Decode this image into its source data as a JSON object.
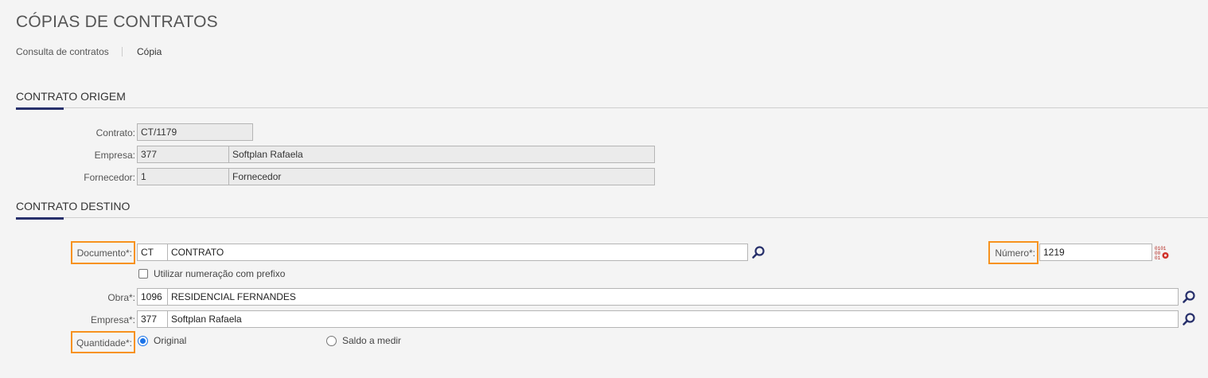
{
  "page": {
    "title": "CÓPIAS DE CONTRATOS"
  },
  "breadcrumb": {
    "items": [
      "Consulta de contratos",
      "Cópia"
    ]
  },
  "origem": {
    "title": "CONTRATO ORIGEM",
    "contrato": {
      "label": "Contrato:",
      "value": "CT/1179"
    },
    "empresa": {
      "label": "Empresa:",
      "code": "377",
      "name": "Softplan Rafaela"
    },
    "fornecedor": {
      "label": "Fornecedor:",
      "code": "1",
      "name": "Fornecedor"
    }
  },
  "destino": {
    "title": "CONTRATO DESTINO",
    "documento": {
      "label": "Documento*:",
      "code": "CT",
      "name": "CONTRATO"
    },
    "numero": {
      "label": "Número*:",
      "value": "1219"
    },
    "prefixo": {
      "label": "Utilizar numeração com prefixo",
      "checked": false
    },
    "obra": {
      "label": "Obra*:",
      "code": "1096",
      "name": "RESIDENCIAL FERNANDES"
    },
    "empresa": {
      "label": "Empresa*:",
      "code": "377",
      "name": "Softplan Rafaela"
    },
    "quantidade": {
      "label": "Quantidade*:",
      "options": [
        "Original",
        "Saldo a medir"
      ],
      "selected": "Original"
    }
  },
  "colors": {
    "highlight": "#f7921e",
    "accent": "#27306b",
    "radio": "#1a73e8",
    "search_icon": "#27306b"
  },
  "icons": {
    "search": "search-icon",
    "number_generator": "number-generator-icon"
  }
}
